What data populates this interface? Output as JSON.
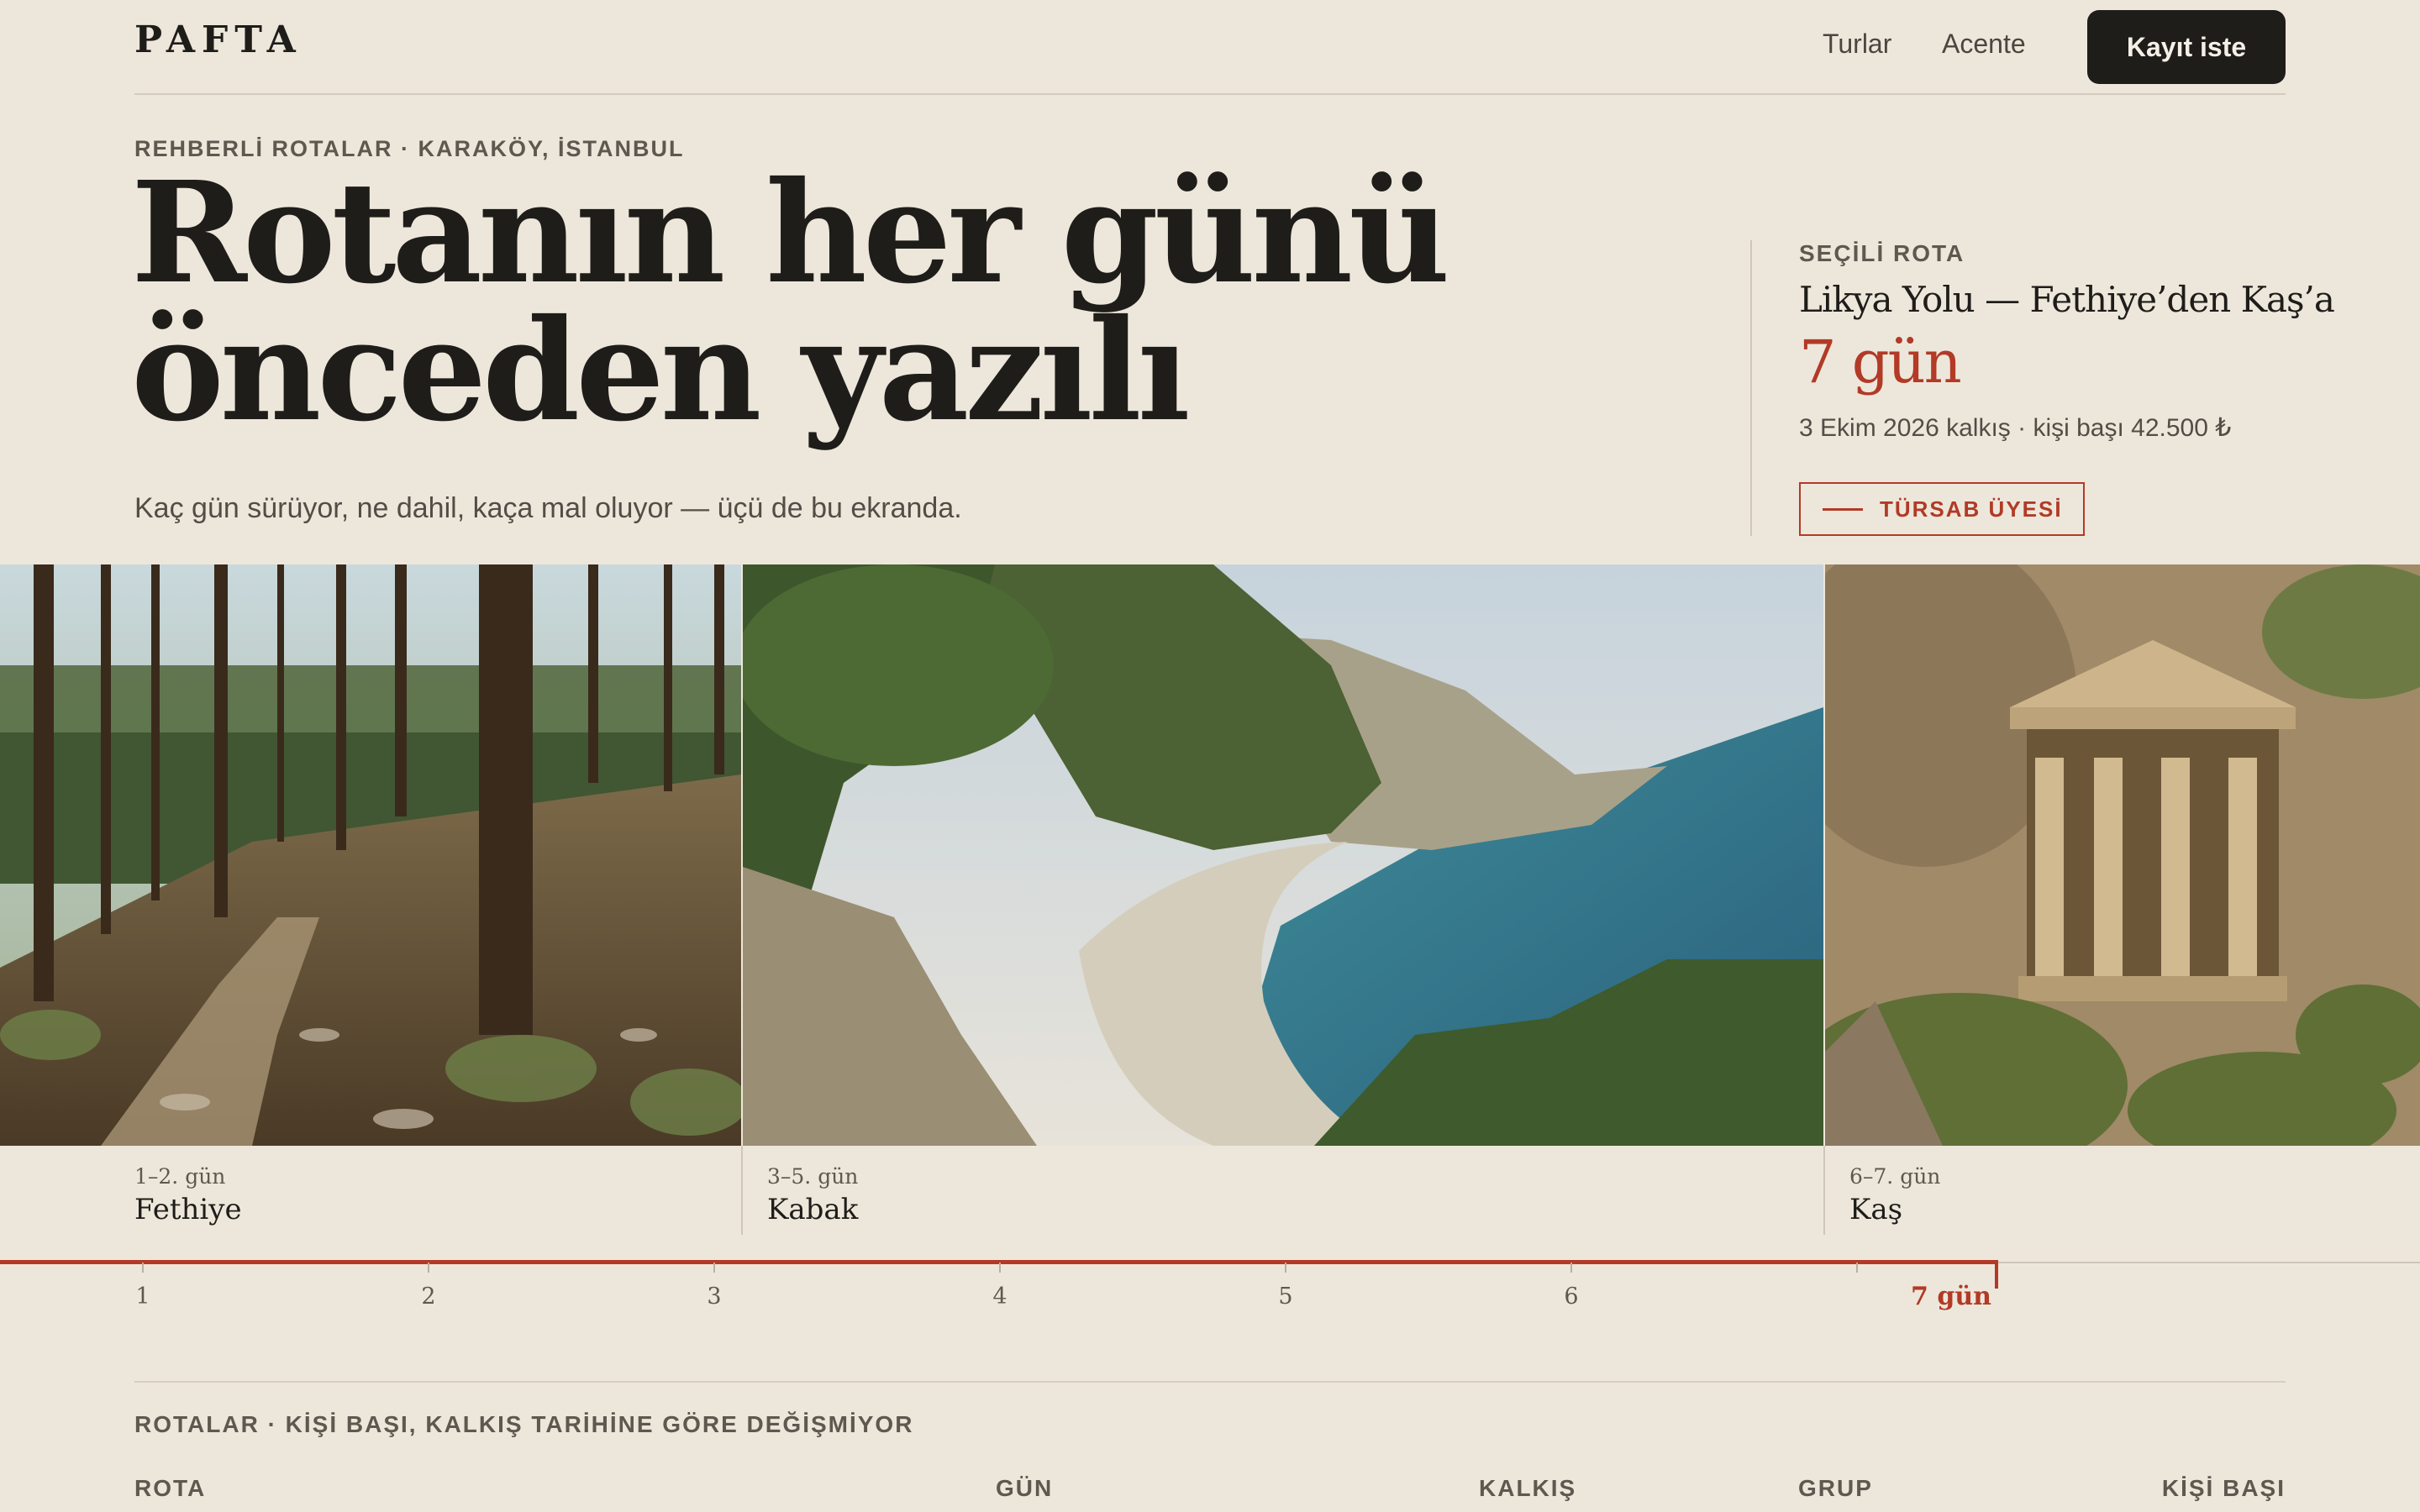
{
  "nav": {
    "logo": "PAFTA",
    "links": [
      "Turlar",
      "Acente"
    ],
    "cta": "Kayıt iste"
  },
  "hero": {
    "eyebrow": "REHBERLİ ROTALAR · KARAKÖY, İSTANBUL",
    "headline_line1": "Rotanın her günü",
    "headline_line2": "önceden yazılı",
    "subline": "Kaç gün sürüyor, ne dahil, kaça mal oluyor — üçü de bu ekranda."
  },
  "selected_route": {
    "label": "SEÇİLİ ROTA",
    "title": "Likya Yolu — Fethiye’den Kaş’a",
    "days": "7 gün",
    "meta": "3 Ekim 2026 kalkış · kişi başı 42.500 ₺",
    "badge": "TÜRSAB ÜYESİ"
  },
  "legs": [
    {
      "range": "1–2. gün",
      "place": "Fethiye",
      "photo": "pine-forest-trail"
    },
    {
      "range": "3–5. gün",
      "place": "Kabak",
      "photo": "coastal-cove"
    },
    {
      "range": "6–7. gün",
      "place": "Kaş",
      "photo": "lycian-rock-tomb"
    }
  ],
  "day_scale": {
    "ticks": [
      "1",
      "2",
      "3",
      "4",
      "5",
      "6",
      "7 gün"
    ],
    "selected_days": 7,
    "accent": "#b23a26"
  },
  "routes_table": {
    "caption": "ROTALAR · KİŞİ BAŞI, KALKIŞ TARİHİNE GÖRE DEĞİŞMİYOR",
    "columns": [
      "ROTA",
      "GÜN",
      "KALKIŞ",
      "GRUP",
      "KİŞİ BAŞI"
    ]
  },
  "colors": {
    "background": "#ede7db",
    "ink": "#1f1d1a",
    "accent": "#b23a26"
  }
}
